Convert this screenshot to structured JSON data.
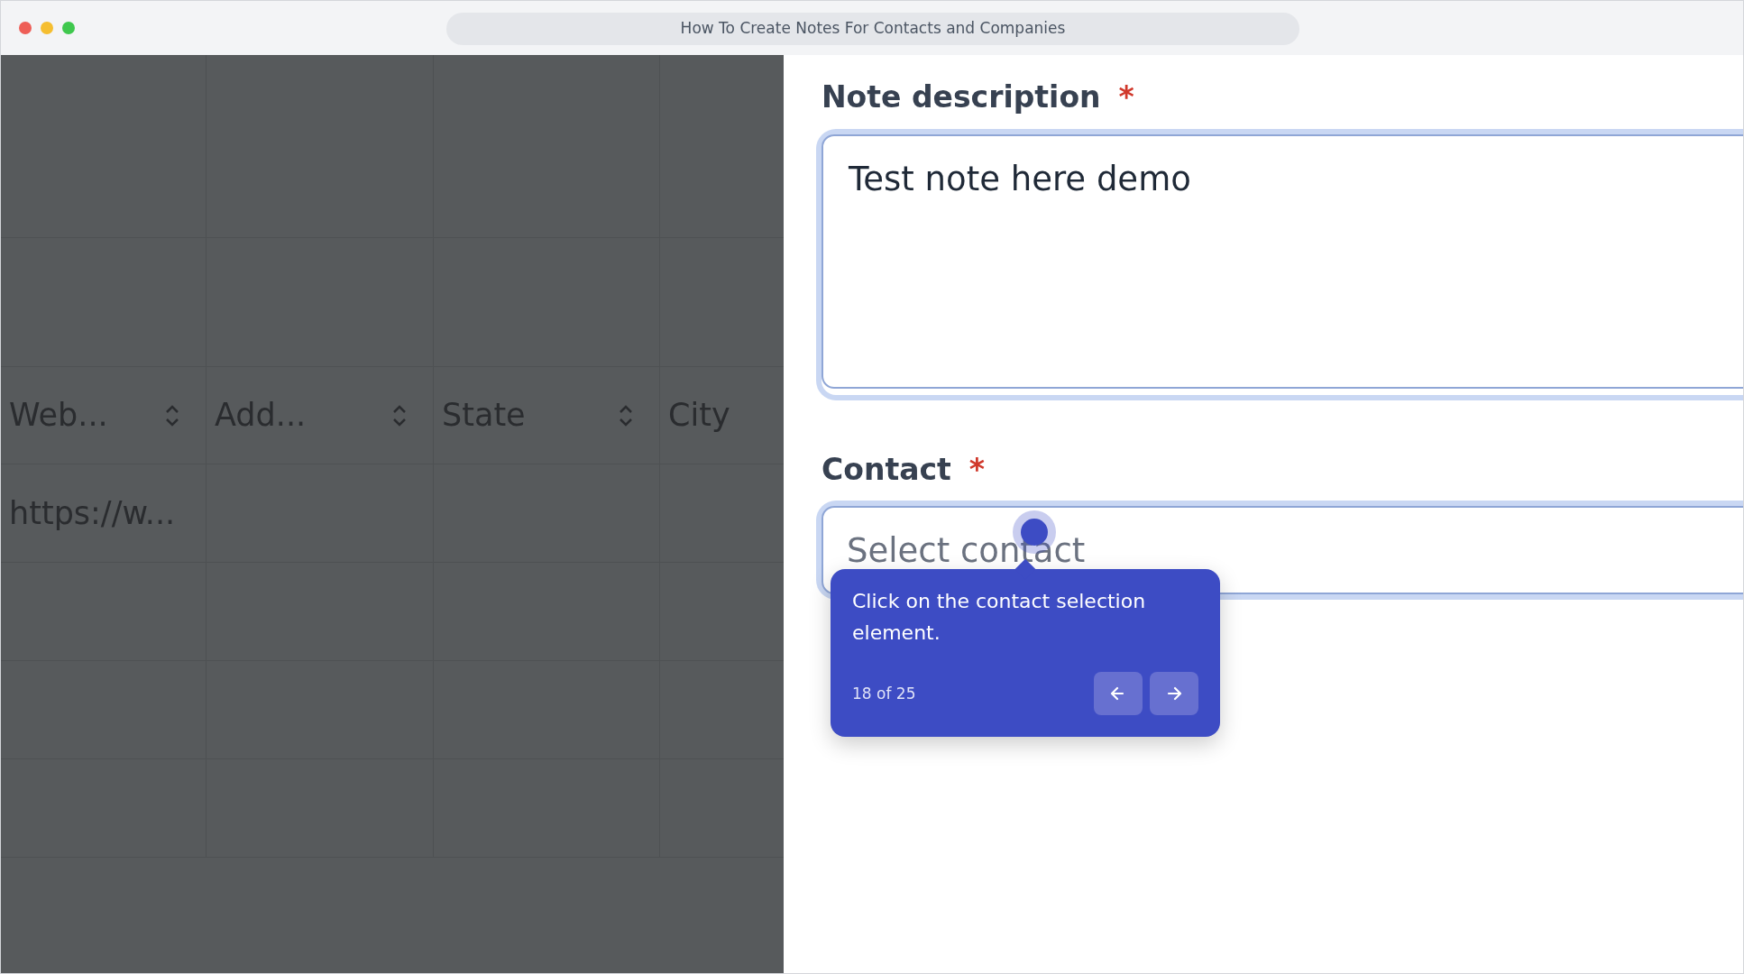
{
  "window": {
    "title": "How To Create Notes For Contacts and Companies"
  },
  "table": {
    "columns": [
      {
        "label": "Web...",
        "sortable": true
      },
      {
        "label": "Add...",
        "sortable": true
      },
      {
        "label": "State",
        "sortable": true
      },
      {
        "label": "City",
        "sortable": false
      }
    ],
    "rows": [
      [
        "https://w...",
        "",
        "",
        ""
      ]
    ]
  },
  "form": {
    "fields": [
      {
        "kind": "textarea",
        "label": "Note description",
        "required_mark": "*",
        "value": "Test note here demo"
      },
      {
        "kind": "select",
        "label": "Contact",
        "required_mark": "*",
        "placeholder": "Select contact"
      }
    ]
  },
  "tooltip": {
    "text": "Click on the contact selection element.",
    "step": "18 of 25"
  }
}
